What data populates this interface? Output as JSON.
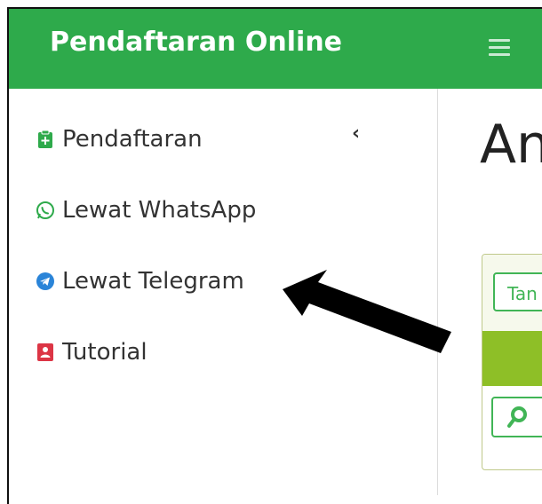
{
  "header": {
    "brand": "Pendaftaran Online"
  },
  "sidebar": {
    "items": [
      {
        "label": "Pendaftaran",
        "icon": "clipboard-plus-icon",
        "color": "#2eaa4b"
      },
      {
        "label": "Lewat WhatsApp",
        "icon": "whatsapp-icon",
        "color": "#2eaa4b"
      },
      {
        "label": "Lewat Telegram",
        "icon": "telegram-icon",
        "color": "#2a84d8"
      },
      {
        "label": "Tutorial",
        "icon": "user-card-icon",
        "color": "#dc3545"
      }
    ],
    "collapse_icon": "chevron-left-icon"
  },
  "main": {
    "title": "An",
    "card": {
      "button_label": "Tan"
    }
  },
  "annotation": {
    "arrow": "pointer-arrow",
    "color": "#000000"
  },
  "colors": {
    "brand_green": "#2eaa4b",
    "band_green": "#8ebf27"
  }
}
